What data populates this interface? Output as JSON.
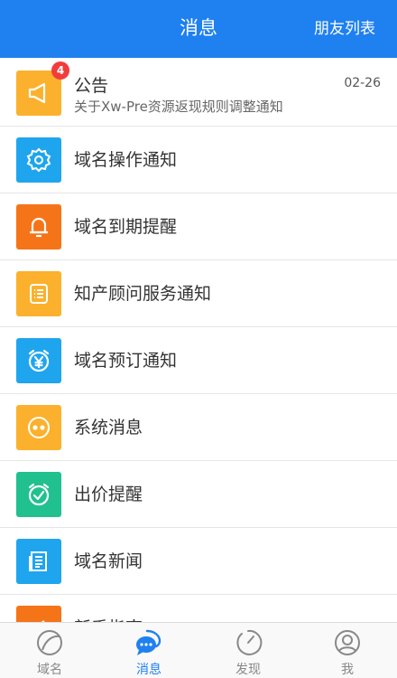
{
  "header": {
    "title": "消息",
    "right_label": "朋友列表"
  },
  "colors": {
    "header": "#1f80f0",
    "badge": "#f23c3c"
  },
  "messages": [
    {
      "icon": "megaphone-icon",
      "color": "#fbb12d",
      "title": "公告",
      "subtitle": "关于Xw-Pre资源返现规则调整通知",
      "time": "02-26",
      "badge": "4"
    },
    {
      "icon": "gear-icon",
      "color": "#1fa5ee",
      "title": "域名操作通知"
    },
    {
      "icon": "bell-icon",
      "color": "#f67418",
      "title": "域名到期提醒"
    },
    {
      "icon": "list-icon",
      "color": "#fbb12d",
      "title": "知产顾问服务通知"
    },
    {
      "icon": "yen-clock-icon",
      "color": "#1fa5ee",
      "title": "域名预订通知"
    },
    {
      "icon": "dots-icon",
      "color": "#fbb12d",
      "title": "系统消息"
    },
    {
      "icon": "check-clock-icon",
      "color": "#21c08f",
      "title": "出价提醒"
    },
    {
      "icon": "news-icon",
      "color": "#1fa5ee",
      "title": "域名新闻"
    },
    {
      "icon": "guide-icon",
      "color": "#f67418",
      "title": "新手指南"
    }
  ],
  "tabs": [
    {
      "icon": "domain-icon",
      "label": "域名",
      "active": false
    },
    {
      "icon": "chat-icon",
      "label": "消息",
      "active": true
    },
    {
      "icon": "compass-icon",
      "label": "发现",
      "active": false
    },
    {
      "icon": "user-icon",
      "label": "我",
      "active": false
    }
  ]
}
